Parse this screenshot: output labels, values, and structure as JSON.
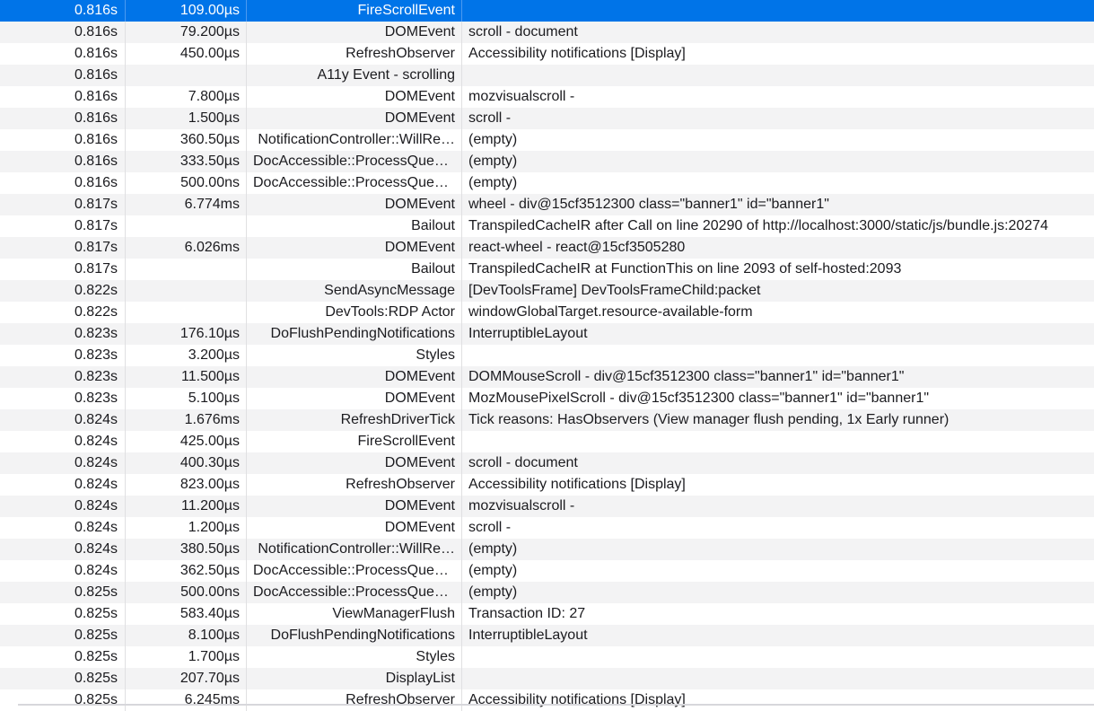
{
  "rows": [
    {
      "start": "0.816s",
      "duration": "109.00µs",
      "name": "FireScrollEvent",
      "details": ""
    },
    {
      "start": "0.816s",
      "duration": "79.200µs",
      "name": "DOMEvent",
      "details": "scroll - document"
    },
    {
      "start": "0.816s",
      "duration": "450.00µs",
      "name": "RefreshObserver",
      "details": "Accessibility notifications [Display]"
    },
    {
      "start": "0.816s",
      "duration": "",
      "name": "A11y Event - scrolling",
      "details": ""
    },
    {
      "start": "0.816s",
      "duration": "7.800µs",
      "name": "DOMEvent",
      "details": "mozvisualscroll -"
    },
    {
      "start": "0.816s",
      "duration": "1.500µs",
      "name": "DOMEvent",
      "details": "scroll -"
    },
    {
      "start": "0.816s",
      "duration": "360.50µs",
      "name": "NotificationController::WillRe…",
      "details": "(empty)"
    },
    {
      "start": "0.816s",
      "duration": "333.50µs",
      "name": "DocAccessible::ProcessQueu…",
      "details": "(empty)"
    },
    {
      "start": "0.816s",
      "duration": "500.00ns",
      "name": "DocAccessible::ProcessQueu…",
      "details": "(empty)"
    },
    {
      "start": "0.817s",
      "duration": "6.774ms",
      "name": "DOMEvent",
      "details": "wheel - div@15cf3512300 class=\"banner1\" id=\"banner1\""
    },
    {
      "start": "0.817s",
      "duration": "",
      "name": "Bailout",
      "details": "TranspiledCacheIR after Call on line 20290 of http://localhost:3000/static/js/bundle.js:20274"
    },
    {
      "start": "0.817s",
      "duration": "6.026ms",
      "name": "DOMEvent",
      "details": "react-wheel - react@15cf3505280"
    },
    {
      "start": "0.817s",
      "duration": "",
      "name": "Bailout",
      "details": "TranspiledCacheIR at FunctionThis on line 2093 of self-hosted:2093"
    },
    {
      "start": "0.822s",
      "duration": "",
      "name": "SendAsyncMessage",
      "details": "[DevToolsFrame] DevToolsFrameChild:packet"
    },
    {
      "start": "0.822s",
      "duration": "",
      "name": "DevTools:RDP Actor",
      "details": "windowGlobalTarget.resource-available-form"
    },
    {
      "start": "0.823s",
      "duration": "176.10µs",
      "name": "DoFlushPendingNotifications",
      "details": "InterruptibleLayout"
    },
    {
      "start": "0.823s",
      "duration": "3.200µs",
      "name": "Styles",
      "details": ""
    },
    {
      "start": "0.823s",
      "duration": "11.500µs",
      "name": "DOMEvent",
      "details": "DOMMouseScroll - div@15cf3512300 class=\"banner1\" id=\"banner1\""
    },
    {
      "start": "0.823s",
      "duration": "5.100µs",
      "name": "DOMEvent",
      "details": "MozMousePixelScroll - div@15cf3512300 class=\"banner1\" id=\"banner1\""
    },
    {
      "start": "0.824s",
      "duration": "1.676ms",
      "name": "RefreshDriverTick",
      "details": "Tick reasons: HasObservers (View manager flush pending, 1x Early runner)"
    },
    {
      "start": "0.824s",
      "duration": "425.00µs",
      "name": "FireScrollEvent",
      "details": ""
    },
    {
      "start": "0.824s",
      "duration": "400.30µs",
      "name": "DOMEvent",
      "details": "scroll - document"
    },
    {
      "start": "0.824s",
      "duration": "823.00µs",
      "name": "RefreshObserver",
      "details": "Accessibility notifications [Display]"
    },
    {
      "start": "0.824s",
      "duration": "11.200µs",
      "name": "DOMEvent",
      "details": "mozvisualscroll -"
    },
    {
      "start": "0.824s",
      "duration": "1.200µs",
      "name": "DOMEvent",
      "details": "scroll -"
    },
    {
      "start": "0.824s",
      "duration": "380.50µs",
      "name": "NotificationController::WillRe…",
      "details": "(empty)"
    },
    {
      "start": "0.824s",
      "duration": "362.50µs",
      "name": "DocAccessible::ProcessQueu…",
      "details": "(empty)"
    },
    {
      "start": "0.825s",
      "duration": "500.00ns",
      "name": "DocAccessible::ProcessQueu…",
      "details": "(empty)"
    },
    {
      "start": "0.825s",
      "duration": "583.40µs",
      "name": "ViewManagerFlush",
      "details": "Transaction ID: 27"
    },
    {
      "start": "0.825s",
      "duration": "8.100µs",
      "name": "DoFlushPendingNotifications",
      "details": "InterruptibleLayout"
    },
    {
      "start": "0.825s",
      "duration": "1.700µs",
      "name": "Styles",
      "details": ""
    },
    {
      "start": "0.825s",
      "duration": "207.70µs",
      "name": "DisplayList",
      "details": ""
    },
    {
      "start": "0.825s",
      "duration": "6.245ms",
      "name": "RefreshObserver",
      "details": "Accessibility notifications [Display]"
    }
  ],
  "selected_row": 0,
  "colors": {
    "selected_bg": "#0074e8",
    "alt_row_bg": "#f3f3f4",
    "text": "#1b1b1f"
  }
}
